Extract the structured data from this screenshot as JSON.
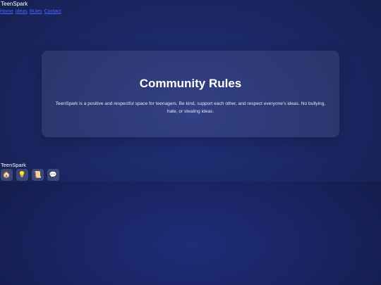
{
  "header": {
    "brand": "TeenSpark",
    "nav": [
      {
        "label": "Home"
      },
      {
        "label": "Ideas"
      },
      {
        "label": "Rules"
      },
      {
        "label": "Contact"
      }
    ]
  },
  "main": {
    "title": "Community Rules",
    "text": "TeenSpark is a positive and respectful space for teenagers. Be kind, support each other, and respect everyone's ideas. No bullying, hate, or stealing ideas."
  },
  "footer": {
    "brand": "TeenSpark",
    "nav_icons": [
      {
        "icon": "home-icon",
        "glyph": "🏠"
      },
      {
        "icon": "lightbulb-icon",
        "glyph": "💡"
      },
      {
        "icon": "scroll-icon",
        "glyph": "📜"
      },
      {
        "icon": "chat-icon",
        "glyph": "💬"
      }
    ]
  },
  "colors": {
    "background": "#1b2865",
    "link": "#4a63ff",
    "card": "#2a3466"
  }
}
